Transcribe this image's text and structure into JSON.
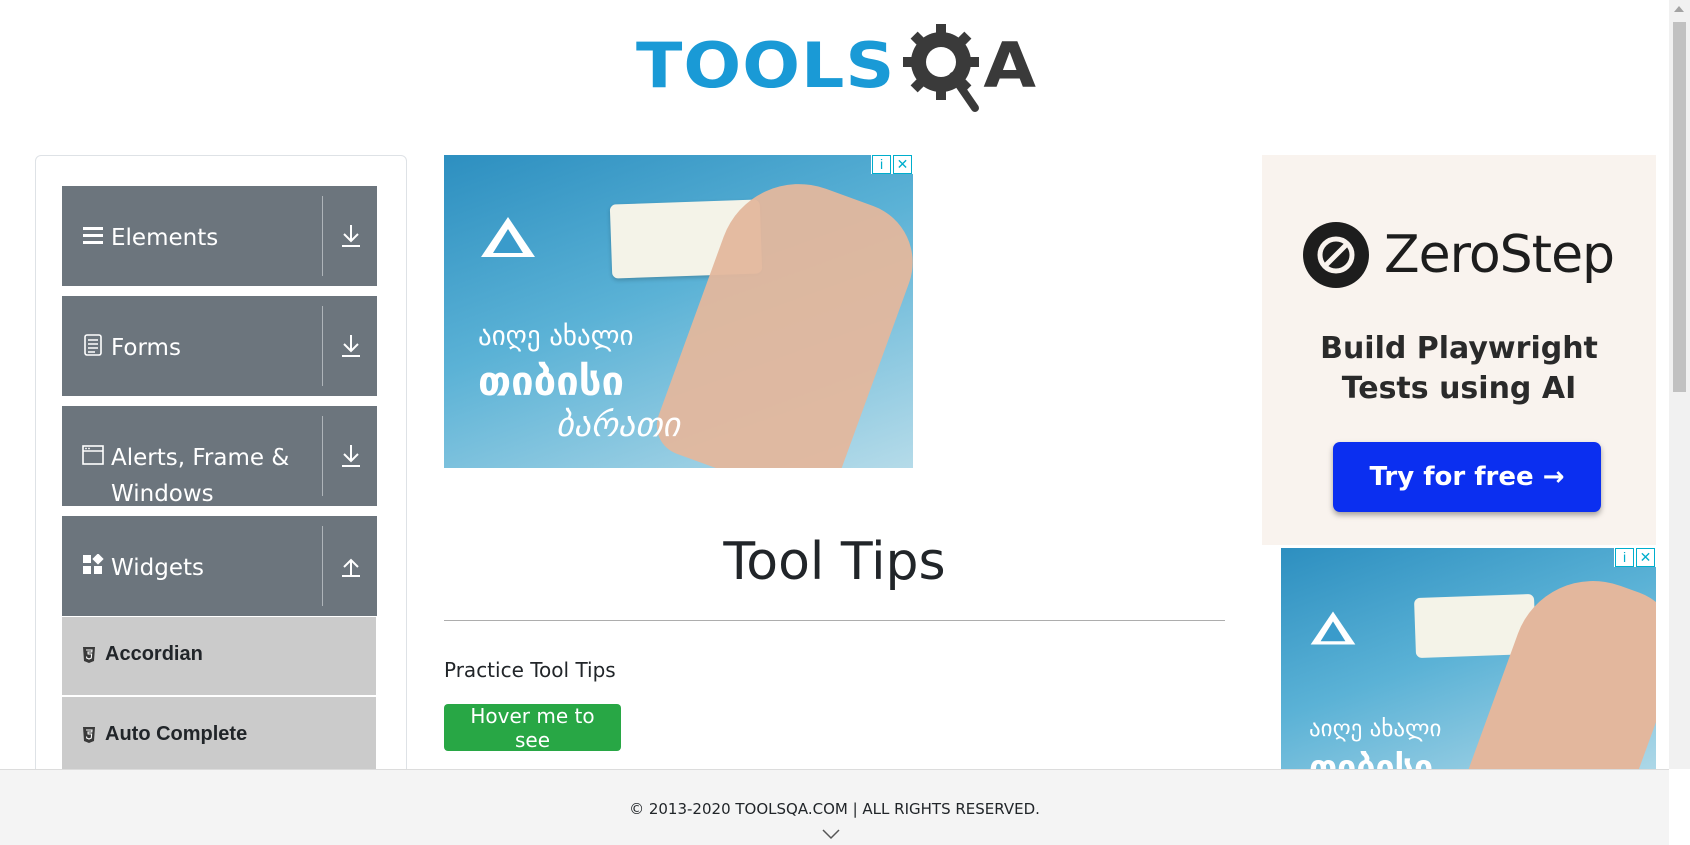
{
  "logo": {
    "text_blue": "TOOLS",
    "text_dark": "A",
    "icon": "gear-magnifier-q-icon"
  },
  "sidebar": {
    "groups": [
      {
        "label": "Elements",
        "icon": "hamburger-icon",
        "toggle": "download-arrow-icon"
      },
      {
        "label": "Forms",
        "icon": "document-icon",
        "toggle": "download-arrow-icon"
      },
      {
        "label": "Alerts, Frame & Windows",
        "icon": "window-icon",
        "toggle": "download-arrow-icon"
      },
      {
        "label": "Widgets",
        "icon": "widgets-icon",
        "toggle": "upload-arrow-icon"
      }
    ],
    "items": [
      {
        "label": "Accordian",
        "icon": "html5-icon"
      },
      {
        "label": "Auto Complete",
        "icon": "html5-icon"
      }
    ]
  },
  "ad_main": {
    "line1": "აიღე ახალი",
    "line2": "თიბისი",
    "line3": "ბარათი"
  },
  "main": {
    "title": "Tool Tips",
    "subtitle": "Practice Tool Tips",
    "hover_button": "Hover me to see"
  },
  "ad_right": {
    "brand": "ZeroStep",
    "tagline_1": "Build Playwright",
    "tagline_2": "Tests using AI",
    "cta": "Try for free →",
    "bottom_line1": "აიღე ახალი",
    "bottom_line2": "თიბისი"
  },
  "footer": {
    "copyright": "© 2013-2020 TOOLSQA.COM | ALL RIGHTS RESERVED."
  },
  "colors": {
    "brand_blue": "#1a9ad6",
    "sidebar_group": "#6c757d",
    "sidebar_item": "#cbcbcb",
    "hover_button": "#28a745",
    "cta_button": "#0b2ff0"
  }
}
